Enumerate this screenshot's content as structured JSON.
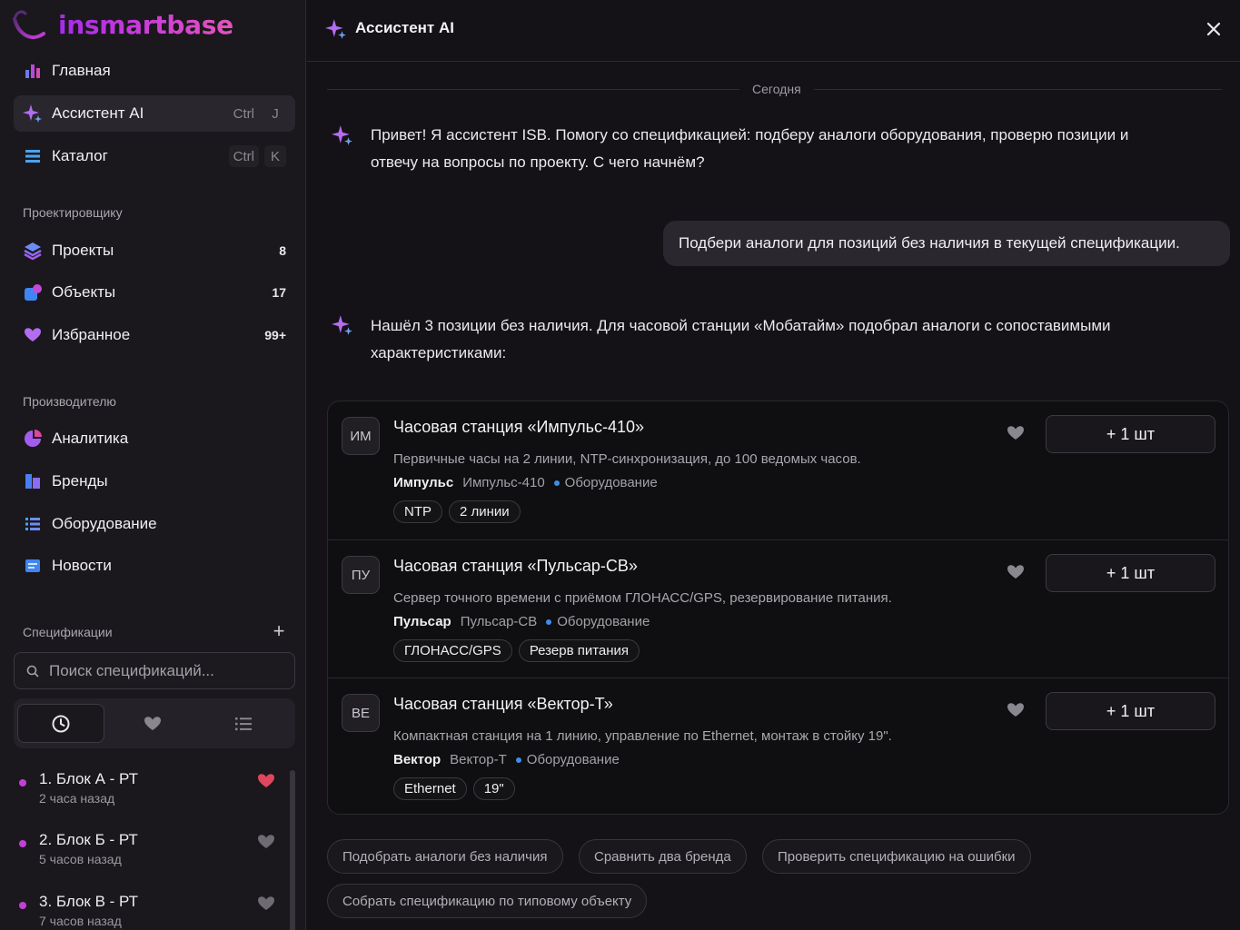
{
  "brand": {
    "name": "insmartbase"
  },
  "sidebar": {
    "nav": [
      {
        "label": "Главная",
        "icon": "bar-chart-icon"
      },
      {
        "label": "Ассистент AI",
        "icon": "sparkle-icon",
        "kbd": [
          "Ctrl",
          "J"
        ],
        "active": true
      },
      {
        "label": "Каталог",
        "icon": "list-icon",
        "kbd": [
          "Ctrl",
          "K"
        ]
      }
    ],
    "designer_section": "Проектировщику",
    "designer_items": [
      {
        "label": "Проекты",
        "count": "8",
        "icon": "layers-icon"
      },
      {
        "label": "Объекты",
        "count": "17",
        "icon": "objects-icon"
      },
      {
        "label": "Избранное",
        "count": "99+",
        "icon": "heart-icon"
      }
    ],
    "manufacturer_section": "Производителю",
    "manufacturer_items": [
      {
        "label": "Аналитика",
        "icon": "pie-chart-icon"
      },
      {
        "label": "Бренды",
        "icon": "brands-icon"
      },
      {
        "label": "Оборудование",
        "icon": "equipment-icon"
      },
      {
        "label": "Новости",
        "icon": "news-icon"
      }
    ],
    "specs_section": "Спецификации",
    "search_placeholder": "Поиск спецификаций...",
    "specs": [
      {
        "name": "1. Блок А - РТ",
        "time": "2 часа назад",
        "favorite": true
      },
      {
        "name": "2. Блок Б - РТ",
        "time": "5 часов назад",
        "favorite": false
      },
      {
        "name": "3. Блок В - РТ",
        "time": "7 часов назад",
        "favorite": false
      }
    ]
  },
  "chat": {
    "title": "Ассистент AI",
    "date_label": "Сегодня",
    "greeting_line1": "Привет! Я ассистент ISB. Помогу со спецификацией: подберу аналоги оборудования, проверю позиции и",
    "greeting_line2": "отвечу на вопросы по проекту. С чего начнём?",
    "user_message": "Подбери аналоги для позиций без наличия в текущей спецификации.",
    "reply_line1": "Нашёл 3 позиции без наличия. Для часовой станции «Мобатайм» подобрал аналоги с сопоставимыми",
    "reply_line2": "характеристиками:",
    "items": [
      {
        "initials": "ИМ",
        "title": "Часовая станция «Импульс-410»",
        "desc": "Первичные часы на 2 линии, NTP-синхронизация, до 100 ведомых часов.",
        "brand": "Импульс",
        "model": "Импульс-410",
        "category": "Оборудование",
        "tags": [
          "NTP",
          "2 линии"
        ],
        "add": "+ 1 шт"
      },
      {
        "initials": "ПУ",
        "title": "Часовая станция «Пульсар-СВ»",
        "desc": "Сервер точного времени с приёмом ГЛОНАСС/GPS, резервирование питания.",
        "brand": "Пульсар",
        "model": "Пульсар-СВ",
        "category": "Оборудование",
        "tags": [
          "ГЛОНАСС/GPS",
          "Резерв питания"
        ],
        "add": "+ 1 шт"
      },
      {
        "initials": "ВЕ",
        "title": "Часовая станция «Вектор-Т»",
        "desc": "Компактная станция на 1 линию, управление по Ethernet, монтаж в стойку 19\".",
        "brand": "Вектор",
        "model": "Вектор-Т",
        "category": "Оборудование",
        "tags": [
          "Ethernet",
          "19\""
        ],
        "add": "+ 1 шт"
      }
    ],
    "suggestions": [
      "Подобрать аналоги без наличия",
      "Сравнить два бренда",
      "Проверить спецификацию на ошибки",
      "Собрать спецификацию по типовому объекту"
    ]
  },
  "colors": {
    "accent": "#c43fd9",
    "brand_gradient_start": "#a52be9",
    "brand_gradient_end": "#e255b8",
    "category_dot": "#3e8ee8",
    "favorite": "#e0465e"
  }
}
